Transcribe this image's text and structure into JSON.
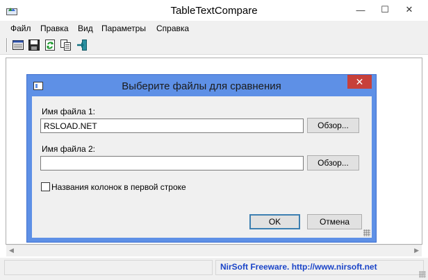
{
  "window": {
    "title": "TableTextCompare",
    "minimize_glyph": "—",
    "maximize_glyph": "☐",
    "close_glyph": "✕"
  },
  "menu": {
    "items": [
      "Файл",
      "Правка",
      "Вид",
      "Параметры",
      "Справка"
    ]
  },
  "toolbar": {
    "buttons": [
      {
        "icon": "table-view-icon"
      },
      {
        "icon": "save-icon"
      },
      {
        "icon": "refresh-icon"
      },
      {
        "icon": "copy-icon"
      },
      {
        "icon": "exit-icon"
      }
    ]
  },
  "dialog": {
    "title": "Выберите файлы для сравнения",
    "close_glyph": "✕",
    "file1_label": "Имя файла 1:",
    "file1_value": "RSLOAD.NET",
    "file2_label": "Имя файла 2:",
    "file2_value": "",
    "browse_label": "Обзор...",
    "checkbox_label": "Названия колонок в первой строке",
    "checkbox_checked": false,
    "ok_label": "OK",
    "cancel_label": "Отмена"
  },
  "statusbar": {
    "link_text": "NirSoft Freeware.  http://www.nirsoft.net"
  },
  "colors": {
    "dialog_frame": "#5e90e6",
    "close_button": "#c7403a",
    "status_link": "#1a44c8"
  }
}
